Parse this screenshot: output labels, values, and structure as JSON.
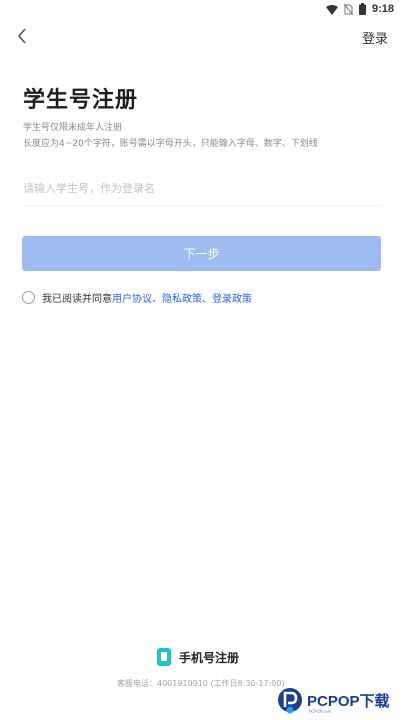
{
  "status_bar": {
    "time": "9:18",
    "icons": [
      "wifi-icon",
      "no-sim-icon",
      "battery-icon"
    ]
  },
  "nav": {
    "back_icon": "chevron-left-icon",
    "login_label": "登录"
  },
  "page": {
    "title": "学生号注册",
    "hint_line_1": "学生号仅限未成年人注册",
    "hint_line_2": "长度应为4~20个字符，账号需以字母开头，只能输入字母、数字、下划线"
  },
  "form": {
    "student_id_placeholder": "请输入学生号，作为登录名",
    "student_id_value": "",
    "next_label": "下一步"
  },
  "agreement": {
    "prefix": "我已阅读并同意",
    "link_user": "用户协议",
    "sep_1": "、",
    "link_privacy": "隐私政策",
    "sep_2": "、",
    "link_login": "登录政策",
    "checked": false
  },
  "footer": {
    "phone_register_label": "手机号注册",
    "phone_icon": "phone-icon",
    "service_line": "客服电话：4001910910 (工作日8:30-17:00)"
  },
  "watermark": {
    "brand": "PCPOP下载",
    "sub": "PCPOP.com"
  },
  "colors": {
    "primary_button": "#9fbcf1",
    "link": "#2f64d6",
    "phone_icon_bg": "#23c1c6",
    "watermark_brand": "#1b3e8e"
  }
}
